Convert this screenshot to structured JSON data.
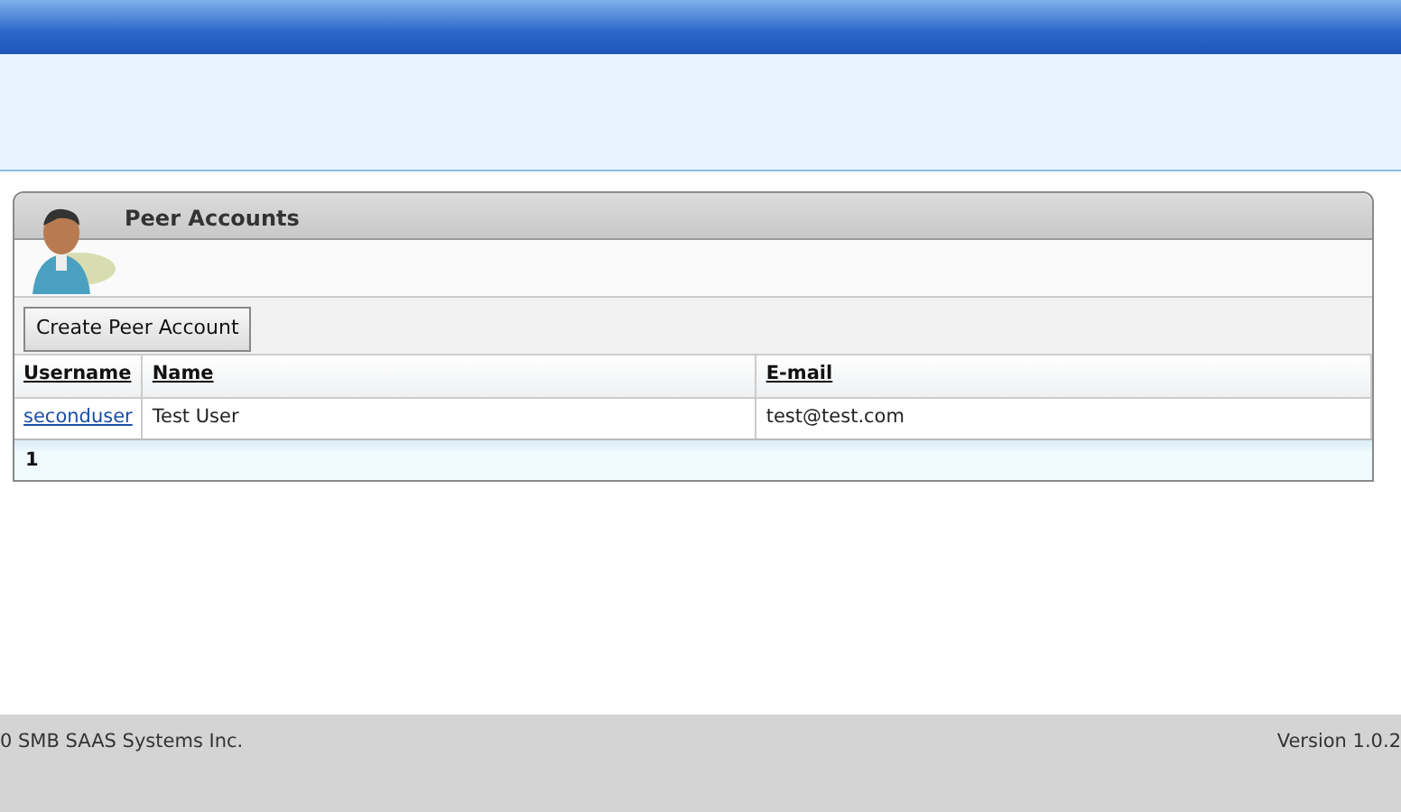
{
  "panel": {
    "title": "Peer Accounts"
  },
  "toolbar": {
    "buttons": [
      "Create Peer Account"
    ]
  },
  "table": {
    "columns": [
      "Username",
      "Name",
      "E-mail"
    ],
    "rows": [
      {
        "cells": [
          "seconduser",
          "Test User",
          "test@test.com"
        ]
      }
    ]
  },
  "pager": {
    "pages": [
      {
        "label": "1",
        "selected": true
      }
    ]
  },
  "footer": {
    "copyright": "0 SMB SAAS Systems Inc.",
    "version": "Version 1.0.2"
  }
}
